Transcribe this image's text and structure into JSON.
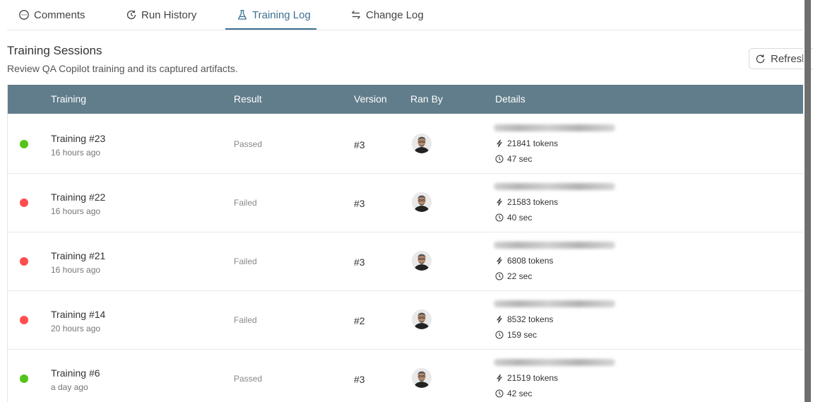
{
  "tabs": [
    {
      "label": "Comments",
      "icon": "comment-icon"
    },
    {
      "label": "Run History",
      "icon": "history-icon"
    },
    {
      "label": "Training Log",
      "icon": "flask-icon",
      "active": true
    },
    {
      "label": "Change Log",
      "icon": "arrows-swap-icon"
    }
  ],
  "header": {
    "title": "Training Sessions",
    "subtitle": "Review QA Copilot training and its captured artifacts.",
    "refresh_label": "Refresh"
  },
  "table": {
    "columns": [
      "Training",
      "Result",
      "Version",
      "Ran By",
      "Details"
    ],
    "rows": [
      {
        "name": "Training #23",
        "time": "16 hours ago",
        "result": "Passed",
        "version": "#3",
        "tokens": "21841 tokens",
        "duration": "47 sec",
        "status": "passed"
      },
      {
        "name": "Training #22",
        "time": "16 hours ago",
        "result": "Failed",
        "version": "#3",
        "tokens": "21583 tokens",
        "duration": "40 sec",
        "status": "failed"
      },
      {
        "name": "Training #21",
        "time": "16 hours ago",
        "result": "Failed",
        "version": "#3",
        "tokens": "6808 tokens",
        "duration": "22 sec",
        "status": "failed"
      },
      {
        "name": "Training #14",
        "time": "20 hours ago",
        "result": "Failed",
        "version": "#2",
        "tokens": "8532 tokens",
        "duration": "159 sec",
        "status": "failed"
      },
      {
        "name": "Training #6",
        "time": "a day ago",
        "result": "Passed",
        "version": "#3",
        "tokens": "21519 tokens",
        "duration": "42 sec",
        "status": "passed"
      }
    ]
  },
  "colors": {
    "accent": "#3d6f92",
    "header_bg": "#617d8b",
    "passed": "#52c41a",
    "failed": "#ff4d4f"
  }
}
